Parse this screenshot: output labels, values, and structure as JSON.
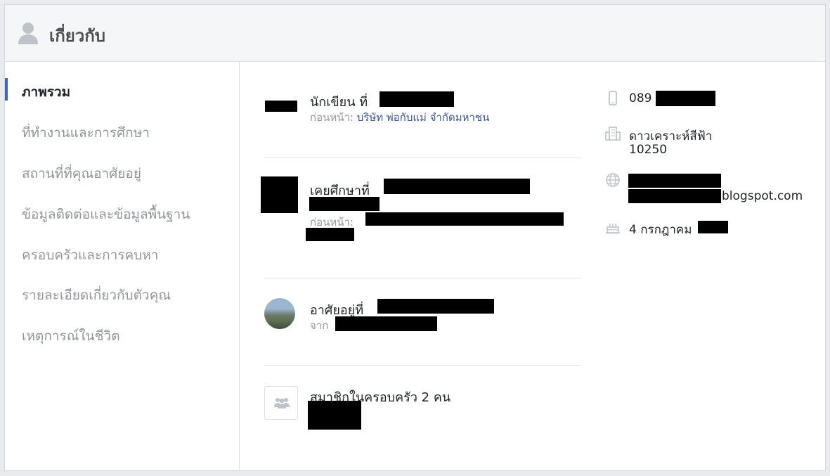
{
  "header": {
    "title": "เกี่ยวกับ"
  },
  "sidebar": {
    "items": [
      {
        "label": "ภาพรวม"
      },
      {
        "label": "ที่ทำงานและการศึกษา"
      },
      {
        "label": "สถานที่ที่คุณอาศัยอยู่"
      },
      {
        "label": "ข้อมูลติดต่อและข้อมูลพื้นฐาน"
      },
      {
        "label": "ครอบครัวและการคบหา"
      },
      {
        "label": "รายละเอียดเกี่ยวกับตัวคุณ"
      },
      {
        "label": "เหตุการณ์ในชีวิต"
      }
    ]
  },
  "overview": {
    "work": {
      "text": "นักเขียน ที่",
      "previous_label": "ก่อนหน้า:",
      "previous_value": "บริษัท พ่อกับแม่ จำกัดมหาชน"
    },
    "education": {
      "text": "เคยศึกษาที่",
      "previous_label": "ก่อนหน้า:"
    },
    "lives": {
      "text": "อาศัยอยู่ที่",
      "from_label": "จาก"
    },
    "family": {
      "text": "สมาชิกในครอบครัว 2 คน"
    }
  },
  "contact": {
    "phone": "089",
    "address_line1": "ดาวเคราะห์สีฟ้า",
    "address_line2": "10250",
    "website_suffix": "blogspot.com",
    "birthday": "4 กรกฎาคม"
  },
  "icons": [
    "person-icon",
    "phone-icon",
    "building-icon",
    "globe-icon",
    "cake-icon",
    "family-icon"
  ],
  "colors": {
    "accent": "#4267b2",
    "link": "#365899",
    "muted": "#90949c"
  }
}
